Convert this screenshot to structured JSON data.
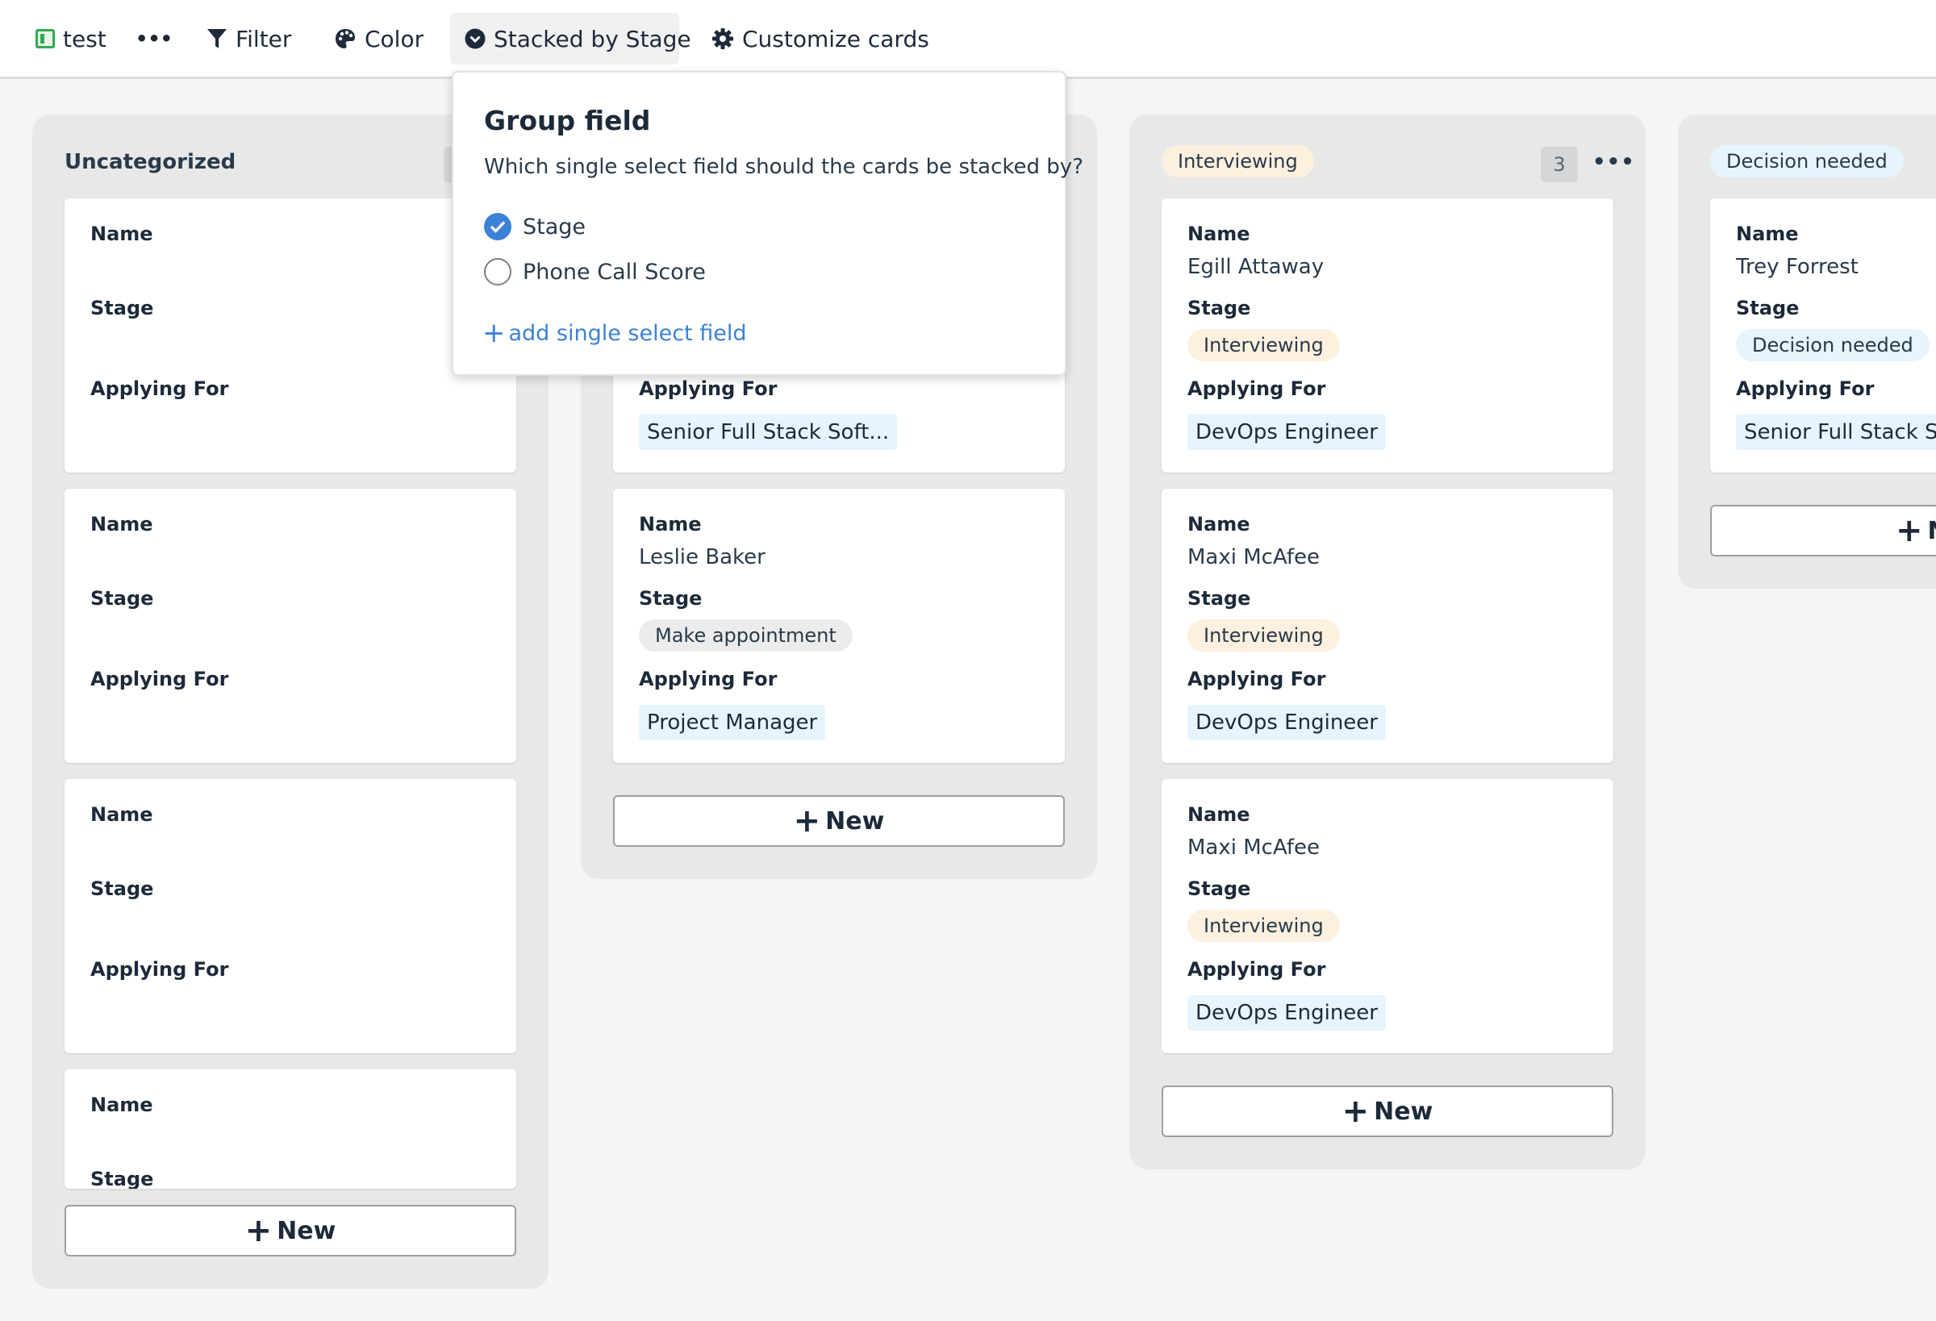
{
  "toolbar": {
    "view_name": "test",
    "more_label": "•••",
    "filter_label": "Filter",
    "color_label": "Color",
    "stacked_label": "Stacked by Stage",
    "customize_label": "Customize cards"
  },
  "labels": {
    "name": "Name",
    "stage": "Stage",
    "applying_for": "Applying For",
    "new": "New"
  },
  "columns": {
    "uncategorized": {
      "title": "Uncategorized"
    },
    "make_appointment": {
      "cards": [
        {
          "applying_for": "Senior Full Stack Soft..."
        },
        {
          "name": "Leslie Baker",
          "stage": "Make appointment",
          "applying_for": "Project Manager"
        }
      ]
    },
    "interviewing": {
      "title": "Interviewing",
      "count": "3",
      "menu": "•••",
      "cards": [
        {
          "name": "Egill Attaway",
          "stage": "Interviewing",
          "applying_for": "DevOps Engineer"
        },
        {
          "name": "Maxi McAfee",
          "stage": "Interviewing",
          "applying_for": "DevOps Engineer"
        },
        {
          "name": "Maxi McAfee",
          "stage": "Interviewing",
          "applying_for": "DevOps Engineer"
        }
      ]
    },
    "decision_needed": {
      "title": "Decision needed",
      "cards": [
        {
          "name": "Trey Forrest",
          "stage": "Decision needed",
          "applying_for": "Senior Full Stack Software Engineer"
        }
      ]
    }
  },
  "popup": {
    "title": "Group field",
    "description": "Which single select field should the cards be stacked by?",
    "options": [
      {
        "label": "Stage",
        "selected": true
      },
      {
        "label": "Phone Call Score",
        "selected": false
      }
    ],
    "add_label": "add single select field"
  },
  "colors": {
    "accent": "#3b82d6",
    "interviewing_badge": "#fdf0df",
    "decision_badge": "#e6f4fc",
    "appointment_badge": "#ececec",
    "tag_bg": "#e6f4fc"
  }
}
